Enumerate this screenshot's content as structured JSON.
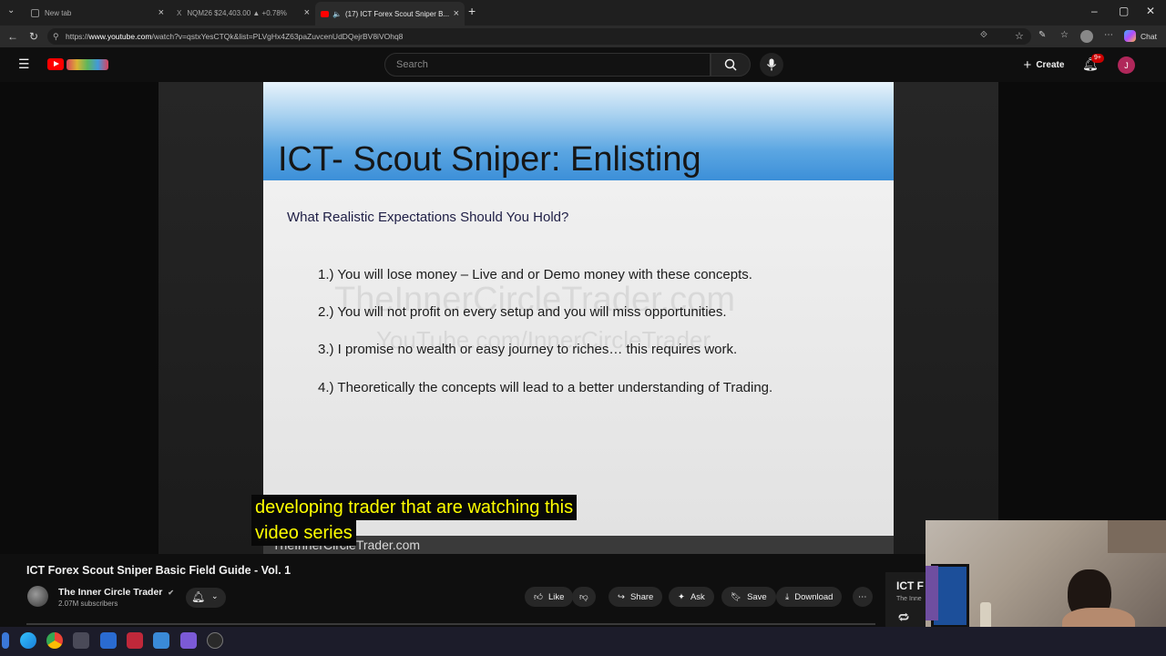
{
  "browser": {
    "tabs": [
      {
        "label": "New tab"
      },
      {
        "label": "NQM26 $24,403.00 ▲ +0.78%"
      },
      {
        "label": "(17) ICT Forex Scout Sniper B..."
      }
    ],
    "url_prefix": "https://",
    "url_host": "www.youtube.com",
    "url_rest": "/watch?v=qstxYesCTQk&list=PLVgHx4Z63paZuvcenUdDQejrBV8iVOhq8",
    "chat_label": "Chat"
  },
  "youtube": {
    "search_placeholder": "Search",
    "create_label": "Create",
    "notif_count": "9+",
    "avatar_initial": "J"
  },
  "slide": {
    "title": "ICT- Scout Sniper: Enlisting",
    "question": "What Realistic Expectations Should You Hold?",
    "points": [
      "1.)  You will lose money – Live and or Demo money with these concepts.",
      "2.)  You will not profit on every setup and you will miss opportunities.",
      "3.)  I promise no wealth or easy journey to riches… this requires work.",
      "4.)  Theoretically the concepts will lead to a better understanding of Trading."
    ],
    "watermark1": "TheInnerCircleTrader.com",
    "watermark2": "YouTube.com/InnerCircleTrader",
    "footer": "TheInnerCircleTrader.com"
  },
  "captions": {
    "line1": "developing trader that are watching this",
    "line2": "video series"
  },
  "video": {
    "title": "ICT Forex Scout Sniper Basic Field Guide - Vol. 1",
    "channel": "The Inner Circle Trader",
    "subscribers": "2.07M subscribers"
  },
  "actions": {
    "like": "Like",
    "share": "Share",
    "ask": "Ask",
    "save": "Save",
    "download": "Download"
  },
  "sidecard": {
    "title": "ICT F",
    "subtitle": "The Inne"
  }
}
